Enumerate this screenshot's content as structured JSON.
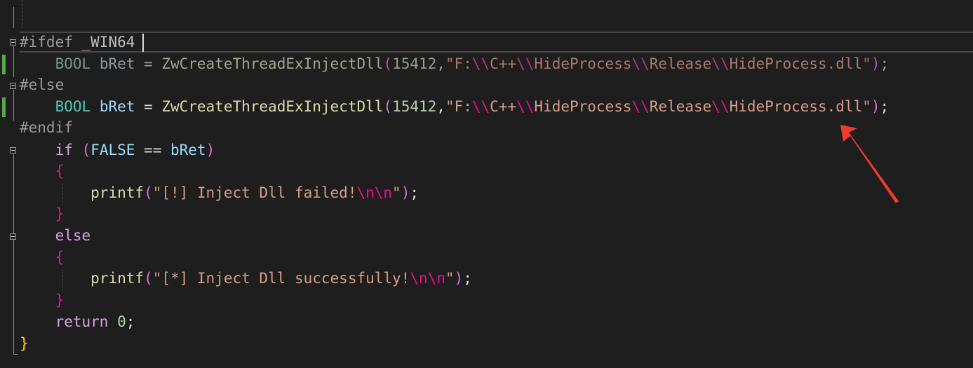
{
  "editor": {
    "lines": [
      {
        "tokens": [
          {
            "t": "#ifdef",
            "c": "pp"
          },
          {
            "t": " ",
            "c": "pp"
          },
          {
            "t": "_WIN64",
            "c": "plain-dim"
          }
        ]
      },
      {
        "tokens": [
          {
            "t": "    ",
            "c": "op"
          },
          {
            "t": "BOOL",
            "c": "type-dim"
          },
          {
            "t": " ",
            "c": "op"
          },
          {
            "t": "bRet",
            "c": "var-dim"
          },
          {
            "t": " = ",
            "c": "op-dim"
          },
          {
            "t": "ZwCreateThreadExInjectDll",
            "c": "fn-dim"
          },
          {
            "t": "(",
            "c": "p1-dim"
          },
          {
            "t": "15412",
            "c": "num-dim"
          },
          {
            "t": ",",
            "c": "op-dim"
          },
          {
            "t": "\"F:",
            "c": "str-dim"
          },
          {
            "t": "\\\\",
            "c": "esc-dim"
          },
          {
            "t": "C++",
            "c": "str-dim"
          },
          {
            "t": "\\\\",
            "c": "esc-dim"
          },
          {
            "t": "HideProcess",
            "c": "str-dim"
          },
          {
            "t": "\\\\",
            "c": "esc-dim"
          },
          {
            "t": "Release",
            "c": "str-dim"
          },
          {
            "t": "\\\\",
            "c": "esc-dim"
          },
          {
            "t": "HideProcess.dll\"",
            "c": "str-dim"
          },
          {
            "t": ")",
            "c": "p1-dim"
          },
          {
            "t": ";",
            "c": "op-dim"
          }
        ]
      },
      {
        "tokens": [
          {
            "t": "#else",
            "c": "pp"
          }
        ]
      },
      {
        "tokens": [
          {
            "t": "    ",
            "c": "op"
          },
          {
            "t": "BOOL",
            "c": "type"
          },
          {
            "t": " ",
            "c": "op"
          },
          {
            "t": "bRet",
            "c": "var"
          },
          {
            "t": " = ",
            "c": "op"
          },
          {
            "t": "ZwCreateThreadExInjectDll",
            "c": "fn"
          },
          {
            "t": "(",
            "c": "p1"
          },
          {
            "t": "15412",
            "c": "num"
          },
          {
            "t": ",",
            "c": "op"
          },
          {
            "t": "\"F:",
            "c": "str"
          },
          {
            "t": "\\\\",
            "c": "esc"
          },
          {
            "t": "C++",
            "c": "str"
          },
          {
            "t": "\\\\",
            "c": "esc"
          },
          {
            "t": "HideProcess",
            "c": "str"
          },
          {
            "t": "\\\\",
            "c": "esc"
          },
          {
            "t": "Release",
            "c": "str"
          },
          {
            "t": "\\\\",
            "c": "esc"
          },
          {
            "t": "HideProcess.dll\"",
            "c": "str"
          },
          {
            "t": ")",
            "c": "p1"
          },
          {
            "t": ";",
            "c": "op"
          }
        ]
      },
      {
        "tokens": [
          {
            "t": "#endif",
            "c": "pp"
          }
        ]
      },
      {
        "tokens": [
          {
            "t": "    ",
            "c": "op"
          },
          {
            "t": "if",
            "c": "cf"
          },
          {
            "t": " ",
            "c": "op"
          },
          {
            "t": "(",
            "c": "p1"
          },
          {
            "t": "FALSE",
            "c": "var"
          },
          {
            "t": " == ",
            "c": "op"
          },
          {
            "t": "bRet",
            "c": "var"
          },
          {
            "t": ")",
            "c": "p1"
          }
        ]
      },
      {
        "tokens": [
          {
            "t": "    ",
            "c": "op"
          },
          {
            "t": "{",
            "c": "p2"
          }
        ]
      },
      {
        "tokens": [
          {
            "t": "        ",
            "c": "op"
          },
          {
            "t": "printf",
            "c": "fn"
          },
          {
            "t": "(",
            "c": "p1"
          },
          {
            "t": "\"[!] Inject Dll failed!",
            "c": "str"
          },
          {
            "t": "\\n\\n",
            "c": "esc"
          },
          {
            "t": "\"",
            "c": "str"
          },
          {
            "t": ")",
            "c": "p1"
          },
          {
            "t": ";",
            "c": "op"
          }
        ]
      },
      {
        "tokens": [
          {
            "t": "    ",
            "c": "op"
          },
          {
            "t": "}",
            "c": "p2"
          }
        ]
      },
      {
        "tokens": [
          {
            "t": "    ",
            "c": "op"
          },
          {
            "t": "else",
            "c": "cf"
          }
        ]
      },
      {
        "tokens": [
          {
            "t": "    ",
            "c": "op"
          },
          {
            "t": "{",
            "c": "p2"
          }
        ]
      },
      {
        "tokens": [
          {
            "t": "        ",
            "c": "op"
          },
          {
            "t": "printf",
            "c": "fn"
          },
          {
            "t": "(",
            "c": "p1"
          },
          {
            "t": "\"[*] Inject Dll successfully!",
            "c": "str"
          },
          {
            "t": "\\n\\n",
            "c": "esc"
          },
          {
            "t": "\"",
            "c": "str"
          },
          {
            "t": ")",
            "c": "p1"
          },
          {
            "t": ";",
            "c": "op"
          }
        ]
      },
      {
        "tokens": [
          {
            "t": "    ",
            "c": "op"
          },
          {
            "t": "}",
            "c": "p2"
          }
        ]
      },
      {
        "tokens": [
          {
            "t": "    ",
            "c": "op"
          },
          {
            "t": "return",
            "c": "cf"
          },
          {
            "t": " ",
            "c": "op"
          },
          {
            "t": "0",
            "c": "num"
          },
          {
            "t": ";",
            "c": "op"
          }
        ]
      },
      {
        "tokens": [
          {
            "t": "}",
            "c": "gold"
          }
        ]
      }
    ]
  },
  "colors": {
    "background": "#1e1e1e",
    "string": "#d69d85",
    "escape": "#e8108c",
    "function": "#dcdcaa",
    "type": "#4ec9b0",
    "variable": "#9cdcfe",
    "number": "#b5cea8",
    "control_keyword": "#d8a0df",
    "brace_outer": "#ffd700",
    "change_bar": "#57a64a",
    "annotation_arrow": "#f03a2e"
  },
  "icons": {
    "fold": "collapse-minus-icon",
    "annotation": "red-arrow-icon"
  }
}
